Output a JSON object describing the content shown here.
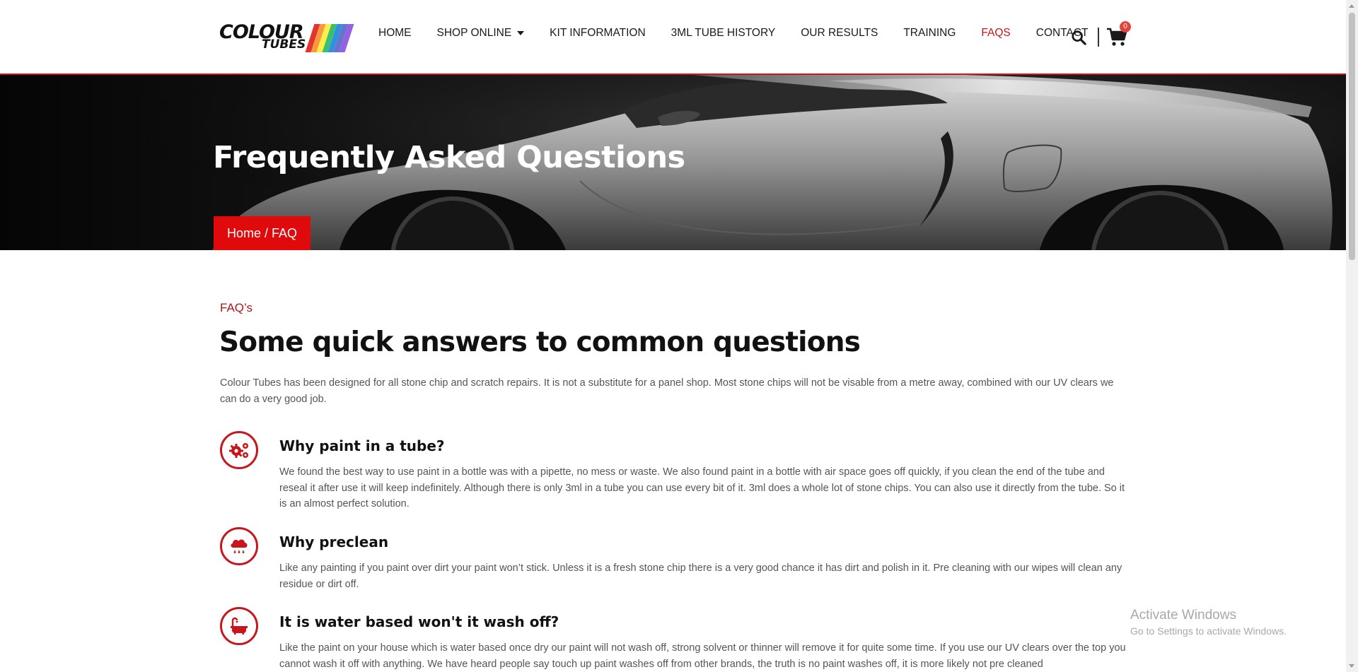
{
  "header": {
    "logo": {
      "word1": "COLOUR",
      "word2": "TUBES",
      "stripe_colors": [
        "#e3342f",
        "#f6993f",
        "#ffed4a",
        "#38c172",
        "#3490dc",
        "#6574cd",
        "#9561e2"
      ]
    },
    "nav": [
      {
        "label": "HOME",
        "active": false
      },
      {
        "label": "SHOP ONLINE",
        "active": false,
        "has_dropdown": true
      },
      {
        "label": "KIT INFORMATION",
        "active": false
      },
      {
        "label": "3ML TUBE HISTORY",
        "active": false
      },
      {
        "label": "OUR RESULTS",
        "active": false
      },
      {
        "label": "TRAINING",
        "active": false
      },
      {
        "label": "FAQS",
        "active": true
      },
      {
        "label": "CONTACT",
        "active": false
      }
    ],
    "search_icon": "search-icon",
    "cart_icon": "cart-icon",
    "cart_count": "0"
  },
  "hero": {
    "title": "Frequently Asked Questions",
    "breadcrumb": {
      "home": "Home",
      "separator": " / ",
      "current": "FAQ"
    }
  },
  "content": {
    "eyebrow": "FAQ’s",
    "title": "Some quick answers to common questions",
    "intro": "Colour Tubes has been designed for all stone chip and scratch repairs. It is not a substitute for a panel shop. Most stone chips will not be visable from a metre away, combined with our UV clears we can do a very good job.",
    "faqs": [
      {
        "icon": "gears-icon",
        "question": "Why paint in a tube?",
        "answer": "We found the best way to use paint in a bottle was with a pipette, no mess or waste. We also found paint in a bottle with air space goes off quickly, if you clean the end of the tube and reseal it after use it will keep indefinitely. Although there is only 3ml in a tube you can use every bit of it. 3ml does a whole lot of stone chips. You can also use it directly from the tube. So it is an almost perfect solution."
      },
      {
        "icon": "cloud-rain-icon",
        "question": "Why preclean",
        "answer": "Like any painting if you paint over dirt your paint won’t stick. Unless it is a fresh stone chip there is a very good chance it has dirt and polish in it. Pre cleaning with our wipes will clean any residue or dirt off."
      },
      {
        "icon": "bathtub-icon",
        "question": "It is water based won't it wash off?",
        "answer": "Like the paint on your house which is water based once dry our paint will not wash off, strong solvent or thinner will remove it for quite some time. If you use our UV clears over the top you cannot wash it off with anything. We have heard people say touch up paint washes off from other brands, the truth is no paint washes off, it is more likely not pre cleaned"
      }
    ]
  },
  "watermark": {
    "line1": "Activate Windows",
    "line2": "Go to Settings to activate Windows."
  },
  "colors": {
    "accent": "#c8161d",
    "breadcrumb_bg": "#e00a0d",
    "text_body": "#555555",
    "text_heading": "#111111"
  }
}
